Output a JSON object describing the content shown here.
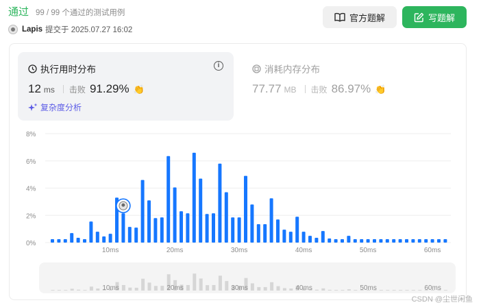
{
  "header": {
    "status": "通过",
    "tests": "99 / 99 个通过的测试用例",
    "user": "Lapis",
    "submitted": "提交于 2025.07.27 16:02"
  },
  "buttons": {
    "official": "官方题解",
    "write": "写题解"
  },
  "runtime": {
    "title": "执行用时分布",
    "value": "12",
    "unit": "ms",
    "beat_label": "击败",
    "beat_value": "91.29%",
    "analysis": "复杂度分析"
  },
  "memory": {
    "title": "消耗内存分布",
    "value": "77.77",
    "unit": "MB",
    "beat_label": "击败",
    "beat_value": "86.97%"
  },
  "colors": {
    "accent": "#2db55d",
    "bar": "#1677ff",
    "bar_faded": "#d6d6d6"
  },
  "chart_data": {
    "type": "bar",
    "ylabel": "",
    "xlabel": "",
    "ylim": [
      0,
      8
    ],
    "yticks": [
      "8%",
      "6%",
      "4%",
      "2%",
      "0%"
    ],
    "yvalues": [
      8,
      6,
      4,
      2,
      0
    ],
    "xticks": [
      "10ms",
      "20ms",
      "30ms",
      "40ms",
      "50ms",
      "60ms"
    ],
    "xvalues": [
      10,
      20,
      30,
      40,
      50,
      60
    ],
    "x": [
      1,
      2,
      3,
      4,
      5,
      6,
      7,
      8,
      9,
      10,
      11,
      12,
      13,
      14,
      15,
      16,
      17,
      18,
      19,
      20,
      21,
      22,
      23,
      24,
      25,
      26,
      27,
      28,
      29,
      30,
      31,
      32,
      33,
      34,
      35,
      36,
      37,
      38,
      39,
      40,
      41,
      42,
      43,
      44,
      45,
      46,
      47,
      48,
      49,
      50,
      51,
      52,
      53,
      54,
      55,
      56,
      57,
      58,
      59,
      60,
      61,
      62
    ],
    "values": [
      0.25,
      0.25,
      0.25,
      0.7,
      0.35,
      0.25,
      1.55,
      0.8,
      0.45,
      0.65,
      3.3,
      2.15,
      1.15,
      1.1,
      4.6,
      3.1,
      1.8,
      1.85,
      6.35,
      4.05,
      2.3,
      2.15,
      6.6,
      4.7,
      2.1,
      2.15,
      5.8,
      3.7,
      1.85,
      1.85,
      4.9,
      2.8,
      1.35,
      1.35,
      3.25,
      1.7,
      0.95,
      0.8,
      1.9,
      0.8,
      0.5,
      0.35,
      0.85,
      0.3,
      0.25,
      0.25,
      0.5,
      0.25,
      0.25,
      0.25,
      0.25,
      0.25,
      0.25,
      0.25,
      0.25,
      0.25,
      0.25,
      0.25,
      0.25,
      0.25,
      0.25,
      0.25
    ],
    "highlight_x": 12,
    "grid": true
  }
}
